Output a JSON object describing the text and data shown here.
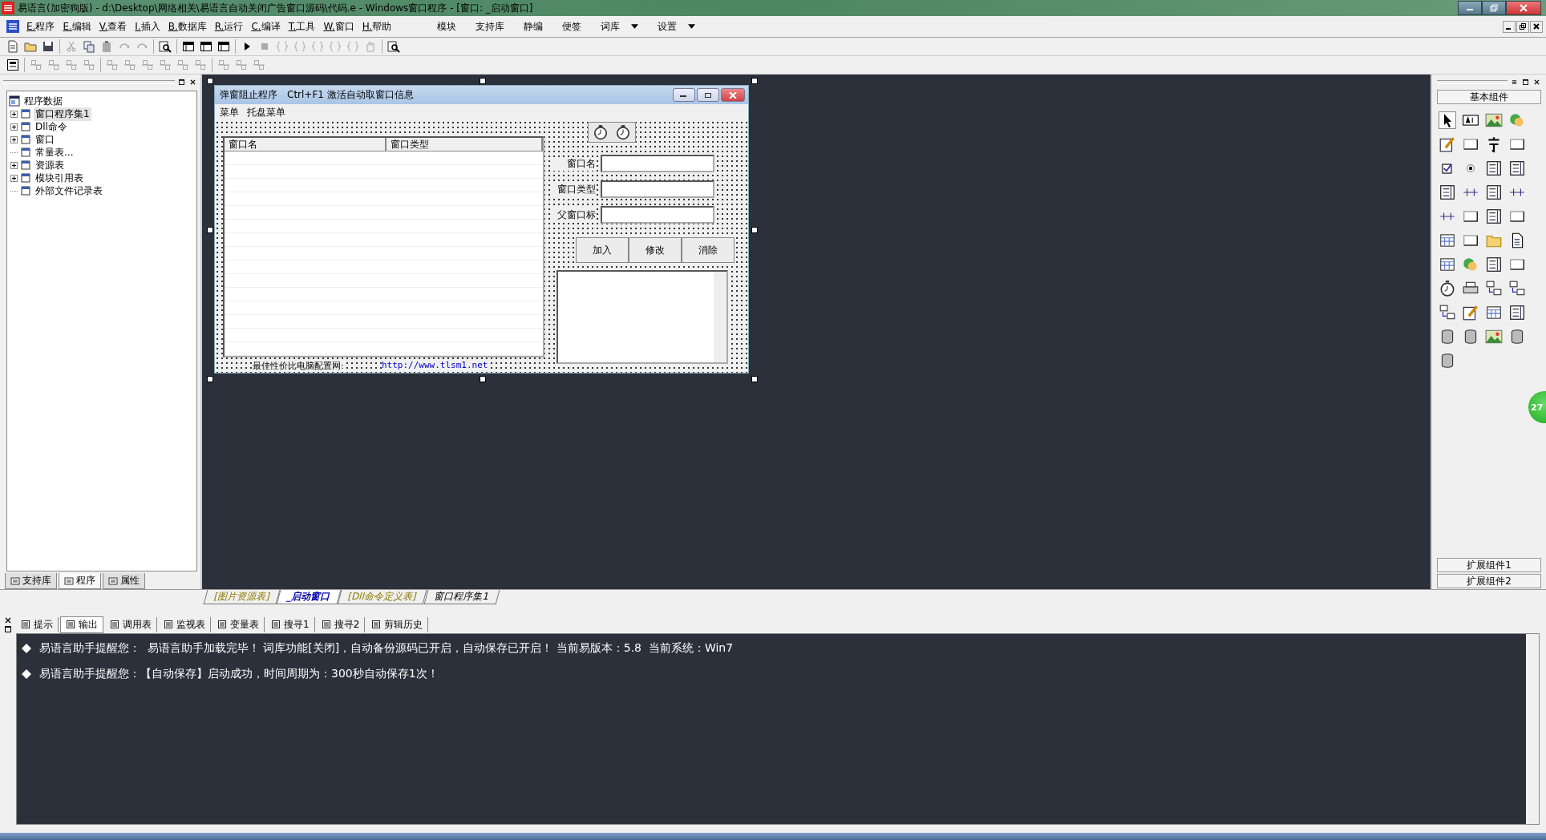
{
  "window": {
    "title": "易语言(加密狗版) - d:\\Desktop\\网络相关\\易语言自动关闭广告窗口源码\\代码.e - Windows窗口程序 - [窗口: _启动窗口]"
  },
  "menu": [
    {
      "label": "E.程序"
    },
    {
      "label": "E.编辑"
    },
    {
      "label": "V.查看"
    },
    {
      "label": "I.插入"
    },
    {
      "label": "B.数据库"
    },
    {
      "label": "R.运行"
    },
    {
      "label": "C.编译"
    },
    {
      "label": "T.工具"
    },
    {
      "label": "W.窗口"
    },
    {
      "label": "H.帮助"
    }
  ],
  "menu_right": [
    {
      "label": "模块",
      "dropdown": false
    },
    {
      "label": "支持库",
      "dropdown": false
    },
    {
      "label": "静编",
      "dropdown": false
    },
    {
      "label": "便签",
      "dropdown": false
    },
    {
      "label": "词库",
      "dropdown": true
    },
    {
      "label": "设置",
      "dropdown": true
    }
  ],
  "tree": {
    "root": "程序数据",
    "items": [
      {
        "label": "窗口程序集1",
        "expandable": true,
        "selected": true
      },
      {
        "label": "Dll命令",
        "expandable": true,
        "selected": false
      },
      {
        "label": "窗口",
        "expandable": true,
        "selected": false
      },
      {
        "label": "常量表...",
        "expandable": false,
        "selected": false
      },
      {
        "label": "资源表",
        "expandable": true,
        "selected": false
      },
      {
        "label": "模块引用表",
        "expandable": true,
        "selected": false
      },
      {
        "label": "外部文件记录表",
        "expandable": false,
        "selected": false
      }
    ]
  },
  "left_tabs": [
    {
      "label": "支持库",
      "selected": false
    },
    {
      "label": "程序",
      "selected": true
    },
    {
      "label": "属性",
      "selected": false
    }
  ],
  "designer": {
    "title": "弹窗阻止程序　Ctrl+F1 激活自动取窗口信息",
    "menu": [
      "菜单",
      "托盘菜单"
    ],
    "list_columns": [
      "窗口名",
      "窗口类型"
    ],
    "fields": [
      {
        "label": "窗口名"
      },
      {
        "label": "窗口类型"
      },
      {
        "label": "父窗口标"
      }
    ],
    "buttons": [
      "加入",
      "修改",
      "消除"
    ],
    "footer_label": "最佳性价比电脑配置网:",
    "footer_link": "http://www.tlsm1.net"
  },
  "doc_tabs": [
    {
      "label": "[图片资源表]",
      "kind": "table",
      "selected": false
    },
    {
      "label": "_启动窗口",
      "kind": "window",
      "selected": true
    },
    {
      "label": "[Dll命令定义表]",
      "kind": "table",
      "selected": false
    },
    {
      "label": "窗口程序集1",
      "kind": "code",
      "selected": false
    }
  ],
  "palette": {
    "title": "基本组件",
    "groups": [
      "扩展组件1",
      "扩展组件2"
    ]
  },
  "float_badge": "27",
  "output_tabs": [
    {
      "label": "提示",
      "selected": false
    },
    {
      "label": "输出",
      "selected": true
    },
    {
      "label": "调用表",
      "selected": false
    },
    {
      "label": "监视表",
      "selected": false
    },
    {
      "label": "变量表",
      "selected": false
    },
    {
      "label": "搜寻1",
      "selected": false
    },
    {
      "label": "搜寻2",
      "selected": false
    },
    {
      "label": "剪辑历史",
      "selected": false
    }
  ],
  "messages": [
    "易语言助手提醒您：  易语言助手加载完毕！ 词库功能[关闭]，自动备份源码已开启，自动保存已开启！ 当前易版本：5.8  当前系统：Win7",
    "易语言助手提醒您：【自动保存】启动成功，时间周期为：300秒自动保存1次！"
  ]
}
